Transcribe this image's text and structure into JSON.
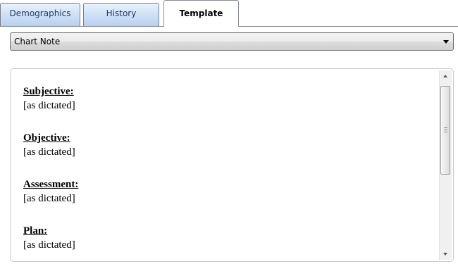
{
  "tabs": [
    {
      "label": "Demographics",
      "active": false
    },
    {
      "label": "History",
      "active": false
    },
    {
      "label": "Template",
      "active": true
    }
  ],
  "template_select": {
    "selected": "Chart Note"
  },
  "note": {
    "sections": [
      {
        "heading": "Subjective:",
        "text": "[as dictated]"
      },
      {
        "heading": "Objective:",
        "text": "[as dictated]"
      },
      {
        "heading": "Assessment:",
        "text": "[as dictated]"
      },
      {
        "heading": "Plan:",
        "text": "[as dictated]"
      }
    ]
  },
  "colors": {
    "tab_gradient_top": "#e9f2fc",
    "tab_gradient_bottom": "#b6d0f0",
    "tab_text": "#1e3c63"
  },
  "icons": {
    "dropdown": "chevron-down-icon",
    "scroll_up": "arrow-up-icon",
    "scroll_down": "arrow-down-icon"
  }
}
